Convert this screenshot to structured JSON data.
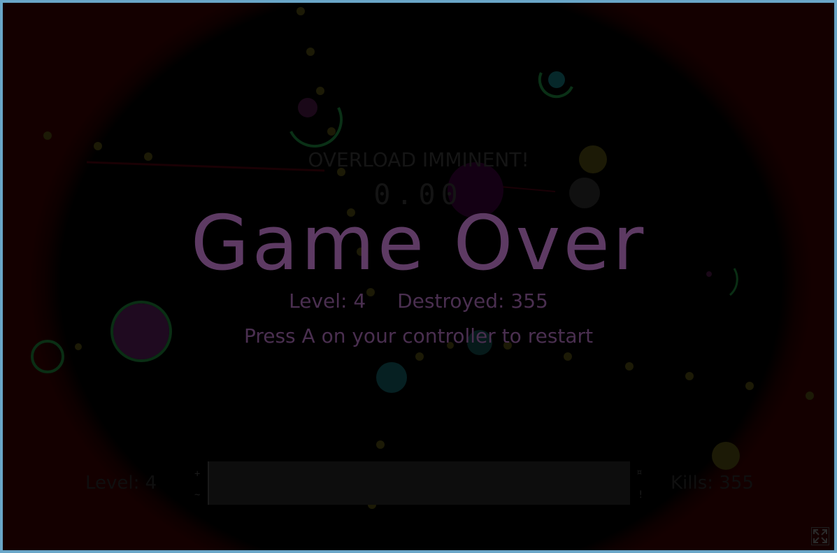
{
  "overlay": {
    "warning": "OVERLOAD IMMINENT!",
    "countdown": "0.00",
    "title": "Game Over",
    "stats": {
      "level": "Level: 4",
      "destroyed": "Destroyed: 355"
    },
    "restart_prompt": "Press A on your controller to restart"
  },
  "hud": {
    "level": "Level: 4",
    "kills": "Kills: 355",
    "bar_left_top": "+",
    "bar_left_bottom": "~",
    "bar_right_top": "¤",
    "bar_right_bottom": "!"
  },
  "colors": {
    "border": "#6aa6c8",
    "title": "#5d3a63",
    "subtitle": "#4a2f50",
    "ring_green": "#0a3a1a",
    "orb_purple": "#1f0a20",
    "orb_yellow": "#24200a",
    "orb_teal": "#062022"
  },
  "icons": {
    "fullscreen": "fullscreen-icon"
  }
}
